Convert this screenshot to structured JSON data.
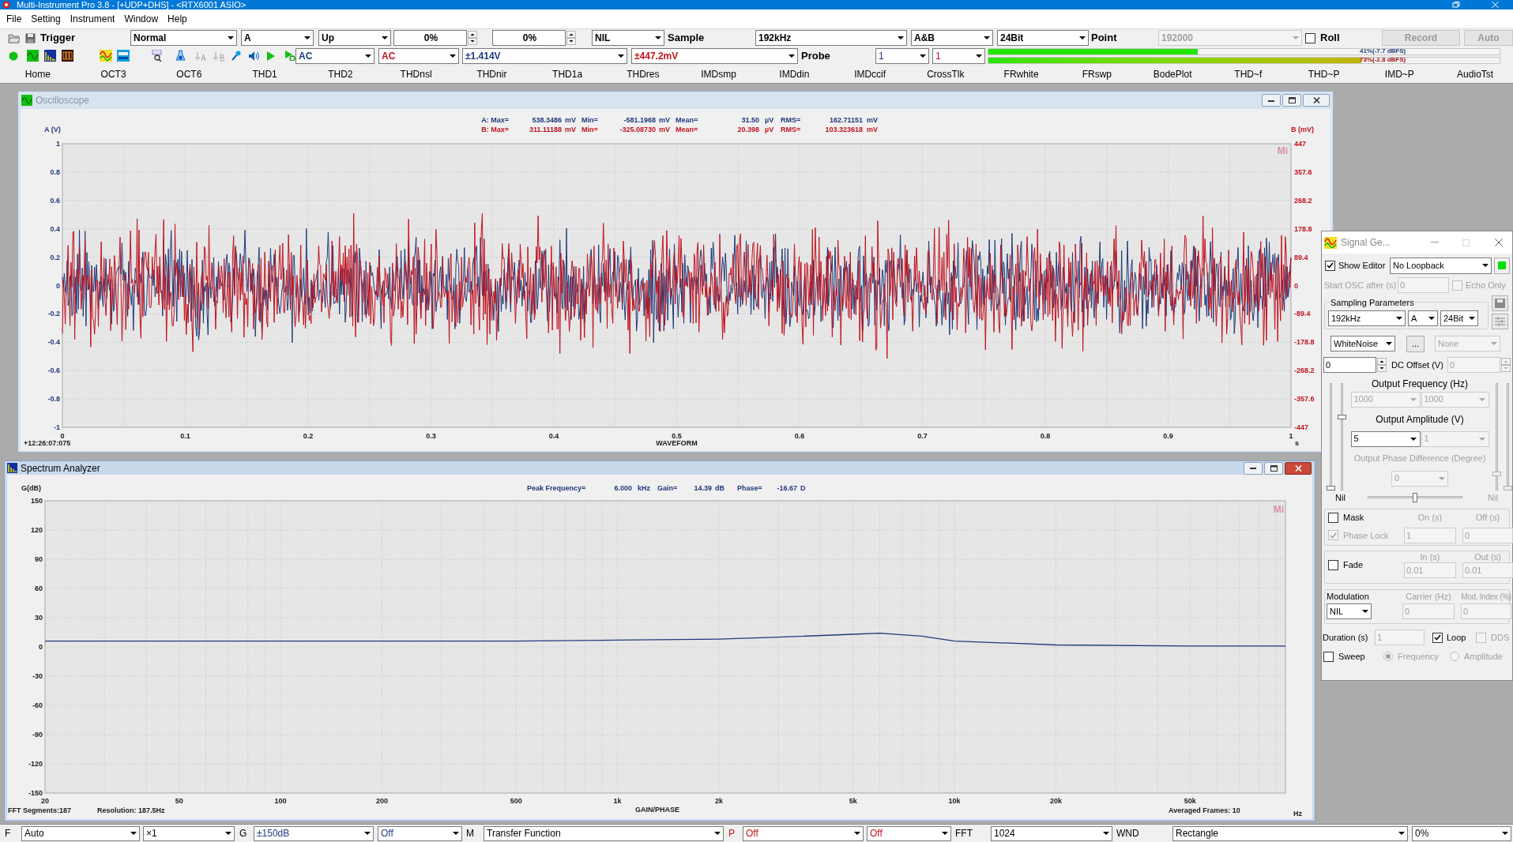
{
  "title_bar": {
    "title": "Multi-Instrument Pro 3.8  -  [+UDP+DHS]  -  <RTX6001 ASIO>"
  },
  "menu": [
    "File",
    "Setting",
    "Instrument",
    "Window",
    "Help"
  ],
  "toolbar": {
    "trigger_label": "Trigger",
    "trigger_mode": "Normal",
    "trigger_source": "A",
    "trigger_edge": "Up",
    "trigger_level": "0%",
    "trigger_delay": "0%",
    "trigger_option": "NIL",
    "sample_label": "Sample",
    "sample_rate": "192kHz",
    "channels": "A&B",
    "bit_depth": "24Bit",
    "point_label": "Point",
    "points": {
      "value": "192000",
      "disabled": true
    },
    "roll": {
      "label": "Roll",
      "checked": false
    },
    "record": {
      "label": "Record",
      "disabled": true
    },
    "auto": {
      "label": "Auto",
      "disabled": true
    },
    "coupling_a": "AC",
    "coupling_b": "AC",
    "range_a": "±1.414V",
    "range_b": "±447.2mV",
    "probe_label": "Probe",
    "probe_a": "1",
    "probe_b": "1",
    "meters": [
      {
        "level": 0.41,
        "reading": "41%(-7.7 dBFS)"
      },
      {
        "level": 0.73,
        "reading": "73%(-2.8 dBFS)"
      }
    ]
  },
  "presets": [
    "Home",
    "OCT3",
    "OCT6",
    "THD1",
    "THD2",
    "THDnsl",
    "THDnir",
    "THD1a",
    "THDres",
    "IMDsmp",
    "IMDdin",
    "IMDccif",
    "CrossTlk",
    "FRwhite",
    "FRswp",
    "BodePlot",
    "THD~f",
    "THD~P",
    "IMD~P",
    "AudioTst"
  ],
  "oscilloscope": {
    "title": "Oscilloscope",
    "active": false,
    "channels": [
      {
        "axis_label": "A (V)",
        "color": "#1f3a7a",
        "stats": [
          "A: Max=",
          "538.3486",
          "mV",
          "Min=",
          "-581.1968",
          "mV",
          "Mean=",
          "31.50",
          "µV",
          "RMS=",
          "162.71151",
          "mV"
        ],
        "ticks": [
          "1",
          "0.8",
          "0.6",
          "0.4",
          "0.2",
          "0",
          "-0.2",
          "-0.4",
          "-0.6",
          "-0.8",
          "-1"
        ]
      },
      {
        "axis_label": "B (mV)",
        "color": "#c0121f",
        "stats": [
          "B: Max=",
          "311.11188",
          "mV",
          "Min=",
          "-325.08730",
          "mV",
          "Mean=",
          "20.398",
          "µV",
          "RMS=",
          "103.323618",
          "mV"
        ],
        "ticks": [
          "447",
          "357.6",
          "268.2",
          "178.8",
          "89.4",
          "0",
          "-89.4",
          "-178.8",
          "-268.2",
          "-357.6",
          "-447"
        ]
      }
    ],
    "xticks": [
      "0",
      "0.1",
      "0.2",
      "0.3",
      "0.4",
      "0.5",
      "0.6",
      "0.7",
      "0.8",
      "0.9",
      "1"
    ],
    "x_unit": "s",
    "xlabel": "WAVEFORM",
    "timestamp": "+12:26:07:075",
    "logo": "Mi"
  },
  "spectrum_analyzer": {
    "title": "Spectrum Analyzer",
    "active": true,
    "logo": "Mi",
    "readout": [
      "Peak Frequency=",
      "6.000",
      "kHz",
      "Gain=",
      "14.39",
      "dB",
      "Phase=",
      "-16.67",
      "D"
    ],
    "fft_segments": "FFT Segments:187",
    "resolution": "Resolution: 187.5Hz",
    "averaged": "Averaged Frames: 10",
    "x_unit": "Hz",
    "xlabel": "GAIN/PHASE",
    "ylabel": "G(dB)",
    "xticks": [
      "20",
      "50",
      "100",
      "200",
      "500",
      "1k",
      "2k",
      "5k",
      "10k",
      "20k",
      "50k"
    ],
    "yticks": [
      "150",
      "120",
      "90",
      "60",
      "30",
      "0",
      "-30",
      "-60",
      "-90",
      "-120",
      "-150"
    ]
  },
  "signal_generator": {
    "title": "Signal Ge...",
    "active": false,
    "show_editor": {
      "label": "Show Editor",
      "checked": true
    },
    "loopback": "No Loopback",
    "start_osc": {
      "label": "Start OSC after (s)",
      "value": "0",
      "disabled": true
    },
    "echo_only": {
      "label": "Echo Only",
      "checked": false,
      "disabled": true
    },
    "sampling": {
      "title": "Sampling Parameters",
      "rate": "192kHz",
      "channel": "A",
      "bits": "24Bit"
    },
    "waveform": "WhiteNoise",
    "waveform_options": "...",
    "waveform_b": {
      "value": "None",
      "disabled": true
    },
    "dc_offset": {
      "value": "0",
      "label": "DC Offset (V)",
      "value_b": "0",
      "disabled_b": true
    },
    "frequency": {
      "label": "Output Frequency (Hz)",
      "value_a": "1000",
      "value_b": "1000",
      "disabled": true
    },
    "amplitude": {
      "label": "Output Amplitude (V)",
      "value_a": "5",
      "value_b": "1",
      "disabled_b": true
    },
    "phase": {
      "label": "Output Phase Difference (Degree)",
      "value": "0",
      "disabled": true
    },
    "sliders_a": [
      {
        "level": 0
      },
      {
        "level": 0.69
      }
    ],
    "nil_a": "Nil",
    "sliders_b": [
      {
        "level": 0.14
      },
      {
        "level": 0
      }
    ],
    "nil_b": {
      "label": "Nil",
      "disabled": true
    },
    "balance": {
      "level": 0.5
    },
    "mask": {
      "label": "Mask",
      "checked": false,
      "on_label": "On (s)",
      "off_label": "Off (s)",
      "on_value": "1",
      "off_value": "0",
      "disabled": true
    },
    "phase_lock": {
      "label": "Phase Lock",
      "checked": true,
      "disabled": true
    },
    "fade": {
      "label": "Fade",
      "checked": false,
      "in_label": "In (s)",
      "out_label": "Out (s)",
      "in_value": "0.01",
      "out_value": "0.01",
      "disabled": true
    },
    "modulation": {
      "label": "Modulation",
      "type": "NIL",
      "carrier_label": "Carrier (Hz)",
      "index_label": "Mod. Index (%)",
      "carrier": "0",
      "index": "0",
      "disabled": true
    },
    "duration": {
      "label": "Duration (s)",
      "value": "1",
      "disabled": true
    },
    "loop": {
      "label": "Loop",
      "checked": true
    },
    "dds": {
      "label": "DDS",
      "checked": false,
      "disabled": true
    },
    "sweep": {
      "label": "Sweep",
      "checked": false
    },
    "sweep_mode": [
      {
        "label": "Frequency",
        "selected": true,
        "disabled": true
      },
      {
        "label": "Amplitude",
        "selected": false,
        "disabled": true
      }
    ]
  },
  "bottom_bar": {
    "f_label": "F",
    "frequency_scale": "Auto",
    "zoom": "×1",
    "g_label": "G",
    "gain_range": "±150dB",
    "gain_option": "Off",
    "m_label": "M",
    "mode": "Transfer Function",
    "p_label": "P",
    "phase_range": "Off",
    "phase_option": "Off",
    "fft_label": "FFT",
    "fft_size": "1024",
    "wnd_label": "WND",
    "window": "Rectangle",
    "overlap": "0%"
  }
}
